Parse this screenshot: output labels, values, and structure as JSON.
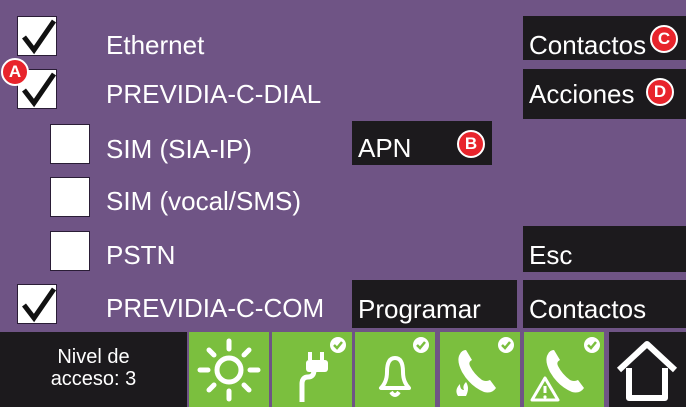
{
  "rows": [
    {
      "label": "Ethernet",
      "checked": true
    },
    {
      "label": "PREVIDIA-C-DIAL",
      "checked": true
    },
    {
      "label": "SIM (SIA-IP)",
      "checked": false
    },
    {
      "label": "SIM (vocal/SMS)",
      "checked": false
    },
    {
      "label": "PSTN",
      "checked": false
    },
    {
      "label": "PREVIDIA-C-COM",
      "checked": true
    }
  ],
  "buttons": {
    "contactos_top": "Contactos",
    "acciones": "Acciones",
    "apn": "APN",
    "esc": "Esc",
    "programar": "Programar",
    "contactos_bottom": "Contactos"
  },
  "badges": {
    "a": "A",
    "b": "B",
    "c": "C",
    "d": "D"
  },
  "bottom_bar": {
    "access_line1": "Nivel de",
    "access_line2": "acceso: 3",
    "tiles": [
      "sun-icon",
      "plug-icon",
      "bell-icon",
      "phone-fire-icon",
      "phone-warning-icon",
      "home-icon"
    ]
  },
  "colors": {
    "background": "#6f5485",
    "button": "#1c1a1d",
    "tile_green": "#7bbf3e",
    "badge_red": "#e8242c"
  }
}
